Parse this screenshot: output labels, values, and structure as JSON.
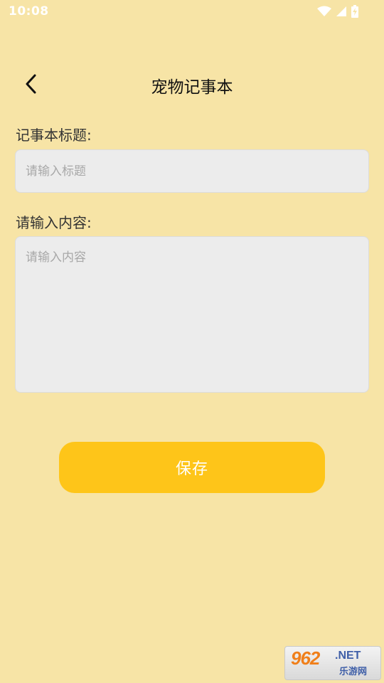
{
  "status_bar": {
    "time": "10:08",
    "icons": [
      "wifi-icon",
      "signal-icon",
      "battery-charging-icon"
    ]
  },
  "header": {
    "title": "宠物记事本",
    "back_icon": "chevron-left-icon"
  },
  "form": {
    "title_label": "记事本标题:",
    "title_placeholder": "请输入标题",
    "title_value": "",
    "content_label": "请输入内容:",
    "content_placeholder": "请输入内容",
    "content_value": ""
  },
  "actions": {
    "save_label": "保存"
  },
  "watermark": {
    "number": "962",
    "domain": ".NET",
    "subtitle": "乐游网"
  },
  "colors": {
    "background": "#f7e4a6",
    "accent": "#fec519",
    "input_bg": "#ececec"
  }
}
